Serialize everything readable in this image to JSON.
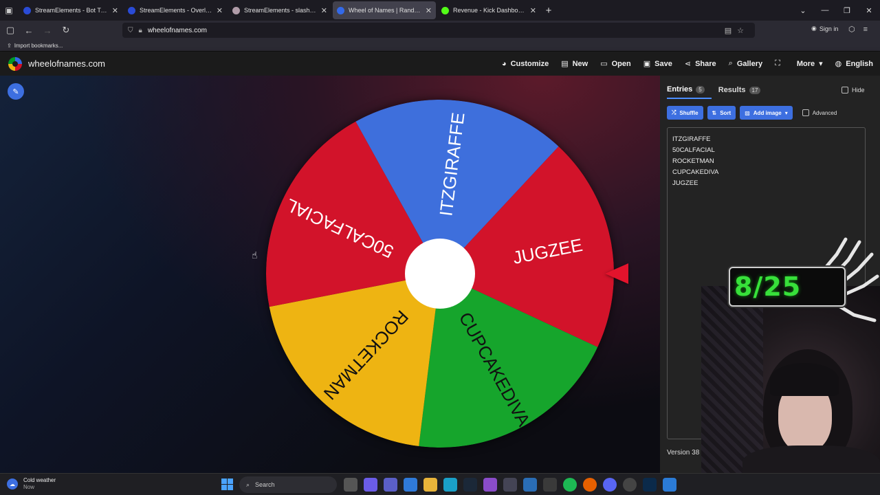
{
  "browser": {
    "tabs": [
      {
        "label": "StreamElements - Bot Timers",
        "color": "#2a4bd6",
        "active": false
      },
      {
        "label": "StreamElements - Overlays",
        "color": "#2a4bd6",
        "active": false
      },
      {
        "label": "StreamElements - slashley",
        "color": "#b09ca8",
        "active": false
      },
      {
        "label": "Wheel of Names | Random nam",
        "color": "#3369e8",
        "active": true
      },
      {
        "label": "Revenue - Kick Dashboard",
        "color": "#53fc18",
        "active": false
      }
    ],
    "url": "wheelofnames.com",
    "signin_label": "Sign in",
    "bookmark_label": "Import bookmarks..."
  },
  "site": {
    "name": "wheelofnames.com",
    "menu": [
      {
        "label": "Customize",
        "icon": "palette-icon"
      },
      {
        "label": "New",
        "icon": "file-icon"
      },
      {
        "label": "Open",
        "icon": "folder-icon"
      },
      {
        "label": "Save",
        "icon": "save-icon"
      },
      {
        "label": "Share",
        "icon": "share-icon"
      },
      {
        "label": "Gallery",
        "icon": "search-icon"
      },
      {
        "label": "",
        "icon": "fullscreen-icon"
      },
      {
        "label": "More",
        "icon": "chevron-down-icon"
      },
      {
        "label": "English",
        "icon": "globe-icon"
      }
    ]
  },
  "wheel": {
    "segments": [
      {
        "name": "ITZGIRAFFE",
        "color": "#3e6fdc"
      },
      {
        "name": "JUGZEE",
        "color": "#d2132a"
      },
      {
        "name": "CUPCAKEDIVA",
        "color": "#16a52c"
      },
      {
        "name": "ROCKETMAN",
        "color": "#eeb412"
      },
      {
        "name": "50CALFACIAL",
        "color": "#d2132a"
      }
    ],
    "rotation_deg": 25
  },
  "sidebar": {
    "tabs": [
      {
        "label": "Entries",
        "count": "5"
      },
      {
        "label": "Results",
        "count": "17"
      }
    ],
    "hide_label": "Hide",
    "buttons": {
      "shuffle": "Shuffle",
      "sort": "Sort",
      "add_image": "Add image"
    },
    "advanced_label": "Advanced",
    "entries": [
      "ITZGIRAFFE",
      "50CALFACIAL",
      "ROCKETMAN",
      "CUPCAKEDIVA",
      "JUGZEE"
    ],
    "version": "Version 38"
  },
  "overlay": {
    "counter": "8/25"
  },
  "taskbar": {
    "weather": "Cold weather",
    "weather_sub": "Now",
    "search_placeholder": "Search"
  }
}
